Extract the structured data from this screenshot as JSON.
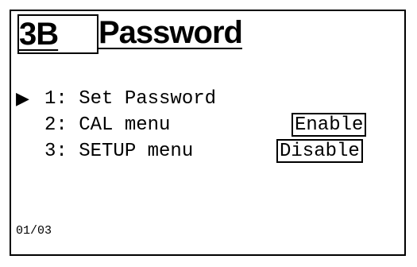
{
  "header": {
    "screen_id": "3B",
    "title": "Password"
  },
  "menu": {
    "cursor": "▶",
    "items": [
      {
        "label": "1: Set Password",
        "value": ""
      },
      {
        "label": "2: CAL menu",
        "value": "Enable"
      },
      {
        "label": "3: SETUP menu",
        "value": "Disable"
      }
    ],
    "selected_index": 0
  },
  "footer": {
    "page_indicator": "01/03"
  }
}
